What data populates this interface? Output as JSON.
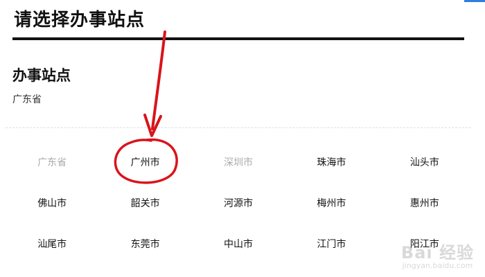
{
  "page": {
    "title": "请选择办事站点"
  },
  "section": {
    "title": "办事站点",
    "subtitle": "广东省"
  },
  "cities": [
    {
      "name": "广东省",
      "disabled": true
    },
    {
      "name": "广州市",
      "disabled": false
    },
    {
      "name": "深圳市",
      "disabled": true
    },
    {
      "name": "珠海市",
      "disabled": false
    },
    {
      "name": "汕头市",
      "disabled": false
    },
    {
      "name": "佛山市",
      "disabled": false
    },
    {
      "name": "韶关市",
      "disabled": false
    },
    {
      "name": "河源市",
      "disabled": false
    },
    {
      "name": "梅州市",
      "disabled": false
    },
    {
      "name": "惠州市",
      "disabled": false
    },
    {
      "name": "汕尾市",
      "disabled": false
    },
    {
      "name": "东莞市",
      "disabled": false
    },
    {
      "name": "中山市",
      "disabled": false
    },
    {
      "name": "江门市",
      "disabled": false
    },
    {
      "name": "阳江市",
      "disabled": false
    }
  ],
  "annotation": {
    "color": "#d9141b"
  },
  "watermark": {
    "main": "Bai 经验",
    "sub": "jingyan.baidu.com"
  }
}
